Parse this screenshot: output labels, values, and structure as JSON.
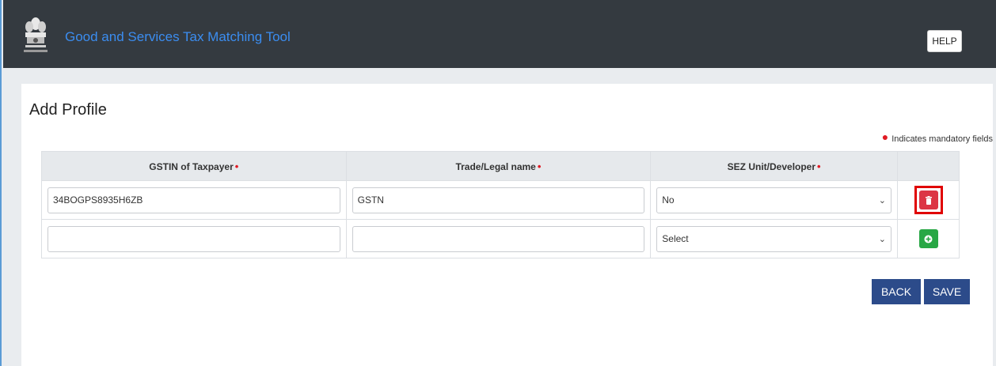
{
  "header": {
    "app_title": "Good and Services Tax Matching Tool",
    "help_label": "HELP"
  },
  "page": {
    "title": "Add Profile",
    "mandatory_note": "Indicates mandatory fields"
  },
  "table": {
    "columns": [
      "GSTIN of Taxpayer",
      "Trade/Legal name",
      "SEZ Unit/Developer"
    ],
    "rows": [
      {
        "gstin": "34BOGPS8935H6ZB",
        "name": "GSTN",
        "sez": "No",
        "action": "delete"
      },
      {
        "gstin": "",
        "name": "",
        "sez": "Select",
        "action": "add"
      }
    ]
  },
  "buttons": {
    "back": "BACK",
    "save": "SAVE"
  },
  "colors": {
    "header_bg": "#343a40",
    "title": "#3b8df0",
    "primary": "#2c4b8a",
    "danger": "#dc3545",
    "success": "#28a745",
    "required": "#e01b24"
  }
}
